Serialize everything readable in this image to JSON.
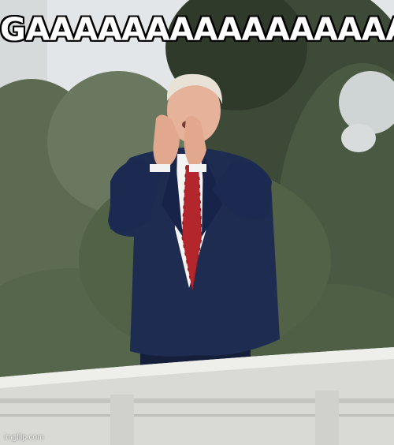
{
  "meme": {
    "caption": "GAAAAAAAAAAAAAAAAY",
    "watermark": "imgflip.com"
  },
  "colors": {
    "sky": "#e4e7e9",
    "foliage": "#55664a",
    "suit": "#1f2c52",
    "tie": "#b3262b",
    "skin": "#e6b29a",
    "hair": "#e8e2d6",
    "wall": "#d9d9d5"
  }
}
